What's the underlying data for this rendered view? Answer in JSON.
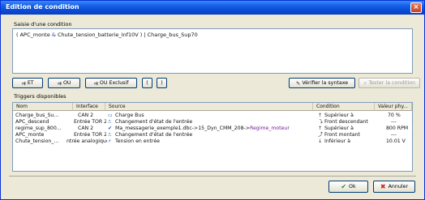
{
  "window": {
    "title": "Edition de condition"
  },
  "condition": {
    "label": "Saisie d'une condition",
    "text_part1": "( APC_monte ",
    "text_amp": "&",
    "text_part2": " Chute_tension_batterie_Inf10V ) | Charge_bus_Sup70"
  },
  "toolbar": {
    "et_label": "ET",
    "ou_label": "OU",
    "ou_exclusif_label": "OU Exclusif",
    "paren_open": "(",
    "paren_close": ")",
    "verify_label": "Vérifier la syntaxe",
    "test_label": "Tester la condition"
  },
  "triggers": {
    "label": "Triggers disponibles",
    "columns": [
      "Nom",
      "Interface",
      "Source",
      "Condition",
      "Valeur phy..."
    ],
    "rows": [
      {
        "nom": "Charge_bus_Su...",
        "interface": "CAN 2",
        "source_icon": "bus-icon",
        "source": "Charge Bus",
        "condition_icon": "arrow-up-icon",
        "condition": "Supérieur à",
        "valeur": "70 %"
      },
      {
        "nom": "APC_descend",
        "interface": "Entrée TOR 2",
        "source_icon": "signal-pulse-icon",
        "source": "Changement d'état de l'entrée",
        "condition_icon": "falling-edge-icon",
        "condition": "Front descendant",
        "valeur": "---"
      },
      {
        "nom": "regime_sup_800...",
        "interface": "CAN 2",
        "source_icon": "check-icon",
        "source_a": "Ma_messagerie_exemple1.dbc->15_Dyn_CMM_208->",
        "source_b": "Regime_moteur",
        "condition_icon": "arrow-up-icon",
        "condition": "Supérieur à",
        "valeur": "800 RPM"
      },
      {
        "nom": "APC_monte",
        "interface": "Entrée TOR 2",
        "source_icon": "signal-pulse-icon",
        "source": "Changement d'état de l'entrée",
        "condition_icon": "rising-edge-icon",
        "condition": "Front montant",
        "valeur": "---"
      },
      {
        "nom": "Chute_tension_...",
        "interface": "ntrée analogique",
        "source_icon": "voltage-icon",
        "source": "Tension en entrée",
        "condition_icon": "arrow-down-icon",
        "condition": "Inférieur à",
        "valeur": "10.01 V"
      }
    ]
  },
  "footer": {
    "ok_label": "Ok",
    "cancel_label": "Annuler"
  },
  "colors": {
    "titlebar": "#0a4bd6",
    "window_bg": "#ece9d8",
    "highlight_text": "#7a1a9a"
  }
}
